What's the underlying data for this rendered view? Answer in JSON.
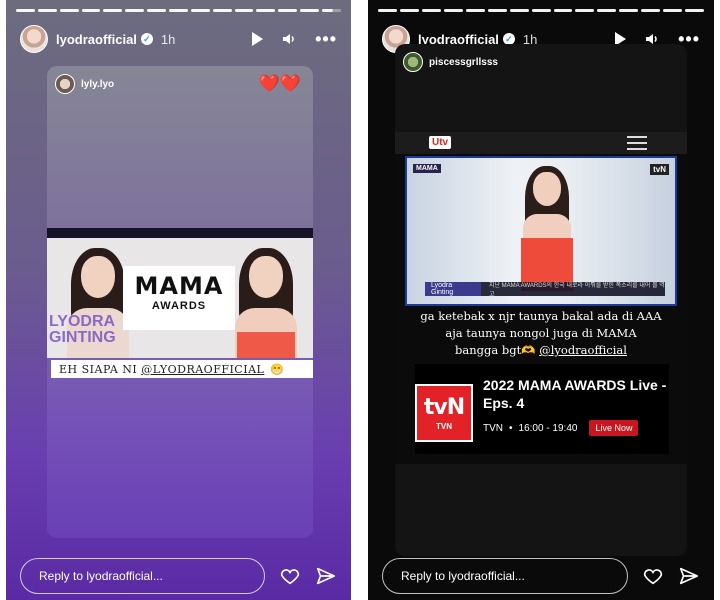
{
  "stories": [
    {
      "username": "lyodraofficial",
      "time": "1h",
      "progress_segments": 15,
      "progress_current_fraction": 0.55,
      "repost": {
        "username": "lyly.lyo",
        "stickers": "❤️❤️",
        "logo_line1": "MAMA",
        "logo_line2": "AWARDS",
        "watermark": "LYODRA\nGINTING",
        "caption_prefix": "EH SIAPA NI",
        "caption_mention": "@LYODRAOFFICIAL",
        "caption_emoji": "😁"
      },
      "reply_placeholder": "Reply to lyodraofficial..."
    },
    {
      "username": "lyodraofficial",
      "time": "1h",
      "progress_segments": 15,
      "progress_current_fraction": 1.0,
      "repost": {
        "username": "piscessgrllsss",
        "channel_logo": "Utv",
        "overlay_left": "MAMA",
        "overlay_right": "tvN",
        "lower_third_name": "Lyodra Ginting",
        "lower_third_text": "지난 MAMA AWARDS의 한국 내로라 이뤄를 받힌 폭소리를 내어 볼 역고",
        "caption_line1": "ga ketebak x njr taunya bakal ada di AAA",
        "caption_line2": "aja taunya nongol juga di MAMA",
        "caption_line3_prefix": "bangga bgt",
        "caption_line3_emoji": "🫶",
        "caption_line3_mention": "@lyodraofficial",
        "program_logo": "tvN",
        "program_logo_sub": "TVN",
        "program_title": "2022 MAMA AWARDS Live - Eps. 4",
        "program_channel": "TVN",
        "program_time": "16:00 - 19:40",
        "live_label": "Live Now"
      },
      "reply_placeholder": "Reply to lyodraofficial..."
    }
  ],
  "icons": {
    "verified": "✓",
    "more": "•••",
    "heart": "♡",
    "volume": "🔈"
  },
  "colors": {
    "left_gradient_top": "#6c6c7e",
    "left_gradient_bottom": "#5a2aa4",
    "right_bg": "#0a0a0a",
    "live_red": "#c9151e",
    "tvn_red": "#e32228"
  }
}
